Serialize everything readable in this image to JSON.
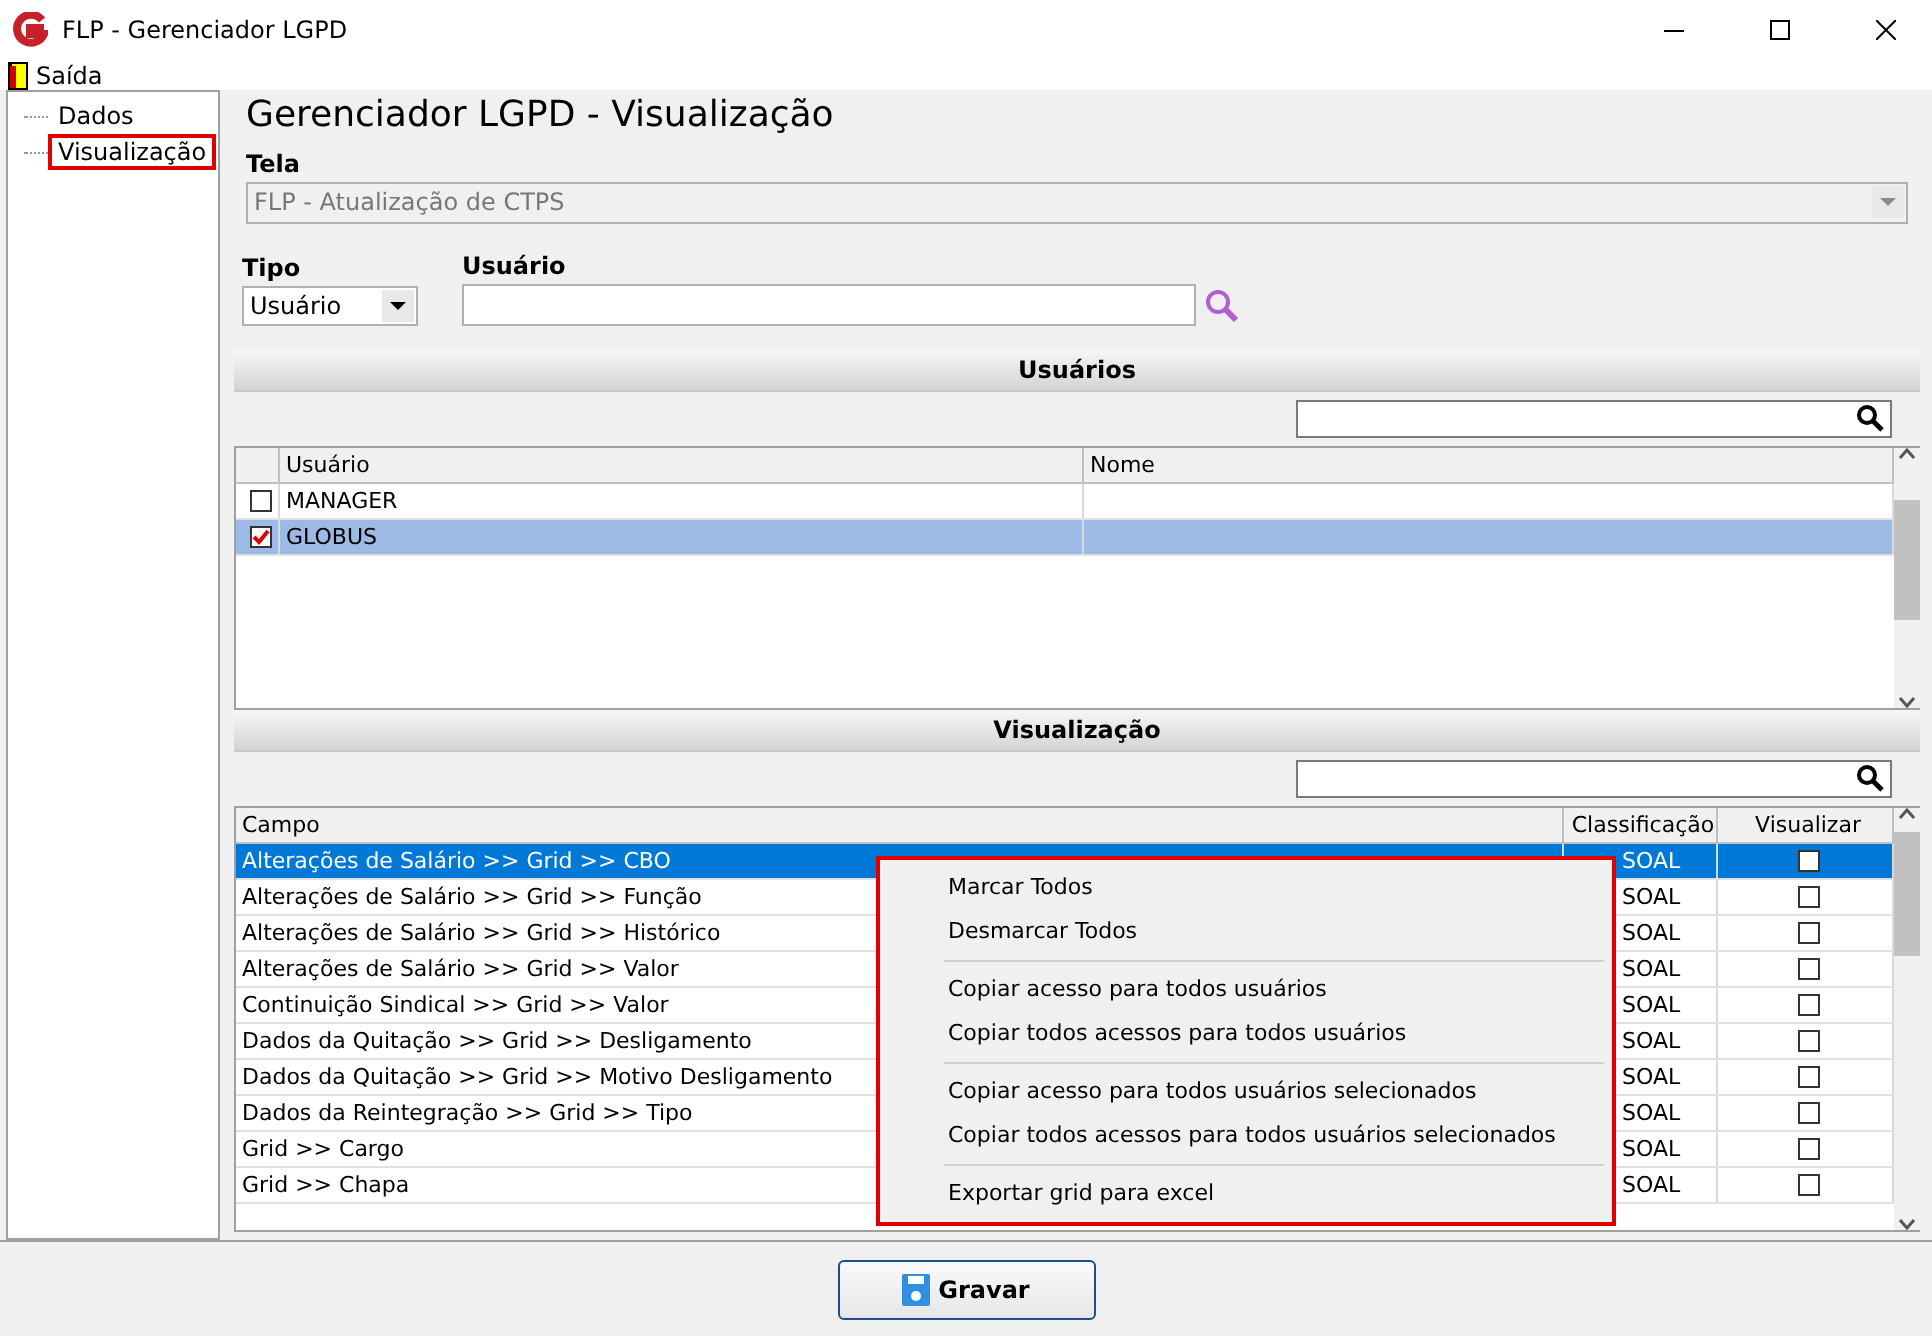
{
  "window": {
    "title": "FLP - Gerenciador LGPD"
  },
  "menu": [
    "Saída"
  ],
  "tree": [
    {
      "label": "Dados",
      "selected": false
    },
    {
      "label": "Visualização",
      "selected": true
    }
  ],
  "heading": "Gerenciador LGPD - Visualização",
  "tela": {
    "label": "Tela",
    "value": "FLP - Atualização de CTPS",
    "disabled": true
  },
  "tipo": {
    "label": "Tipo",
    "value": "Usuário"
  },
  "usuario": {
    "label": "Usuário"
  },
  "users": {
    "title": "Usuários",
    "columns": [
      "Usuário",
      "Nome"
    ],
    "rows": [
      {
        "usuario": "MANAGER",
        "checked": false,
        "selected": false
      },
      {
        "usuario": "GLOBUS",
        "checked": true,
        "selected": true
      }
    ]
  },
  "fields": {
    "title": "Visualização",
    "columns": [
      "Campo",
      "Classificação",
      "Visualizar"
    ],
    "rows": [
      {
        "campo": "Alterações de Salário >> Grid >> CBO",
        "classificacao": "SOAL",
        "checked": false,
        "selected": true
      },
      {
        "campo": "Alterações de Salário >> Grid >> Função",
        "classificacao": "SOAL",
        "checked": false,
        "selected": false
      },
      {
        "campo": "Alterações de Salário >> Grid >> Histórico",
        "classificacao": "SOAL",
        "checked": false,
        "selected": false
      },
      {
        "campo": "Alterações de Salário >> Grid >> Valor",
        "classificacao": "SOAL",
        "checked": false,
        "selected": false
      },
      {
        "campo": "Continuição Sindical >> Grid >> Valor",
        "classificacao": "SOAL",
        "checked": false,
        "selected": false
      },
      {
        "campo": "Dados da Quitação >> Grid >> Desligamento",
        "classificacao": "SOAL",
        "checked": false,
        "selected": false
      },
      {
        "campo": "Dados da Quitação >> Grid >> Motivo Desligamento",
        "classificacao": "SOAL",
        "checked": false,
        "selected": false
      },
      {
        "campo": "Dados da Reintegração >> Grid >> Tipo",
        "classificacao": "SOAL",
        "checked": false,
        "selected": false
      },
      {
        "campo": "Grid >> Cargo",
        "classificacao": "SOAL",
        "checked": false,
        "selected": false
      },
      {
        "campo": "Grid >> Chapa",
        "classificacao": "SOAL",
        "checked": false,
        "selected": false
      }
    ]
  },
  "context_menu": [
    [
      "Marcar Todos",
      "Desmarcar Todos"
    ],
    [
      "Copiar acesso para todos usuários",
      "Copiar todos acessos para todos usuários"
    ],
    [
      "Copiar acesso para todos usuários selecionados",
      "Copiar todos acessos para todos usuários selecionados"
    ],
    [
      "Exportar grid para excel"
    ]
  ],
  "save_button": "Gravar"
}
